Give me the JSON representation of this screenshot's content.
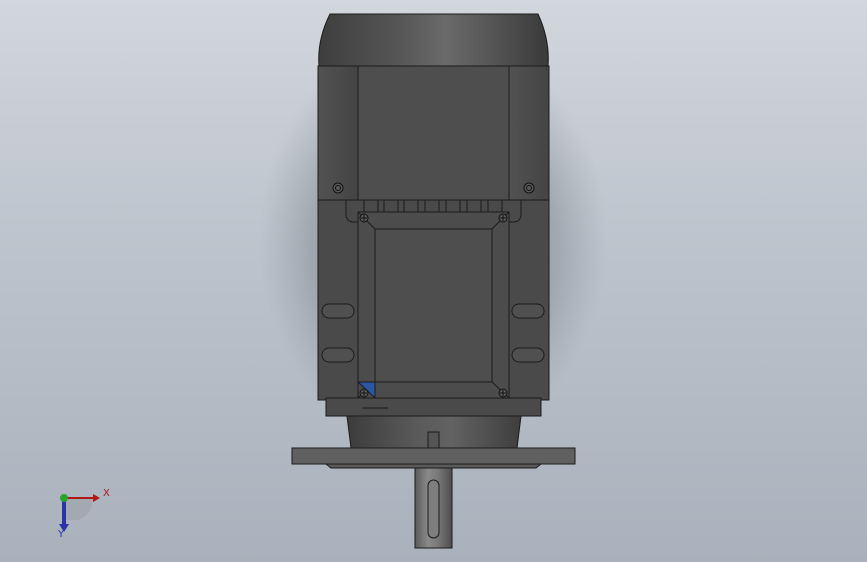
{
  "viewport": {
    "background_top": "#d2d6dd",
    "background_bottom": "#a9b1bc"
  },
  "model": {
    "body_color": "#4a4a4a",
    "edge_color": "#1b1b1b",
    "selected_face_color": "#2b56a3"
  },
  "triad": {
    "x_label": "X",
    "y_label": "Y",
    "x_color": "#b01818",
    "y_color": "#2a35a8",
    "origin_color": "#2aa52a"
  }
}
